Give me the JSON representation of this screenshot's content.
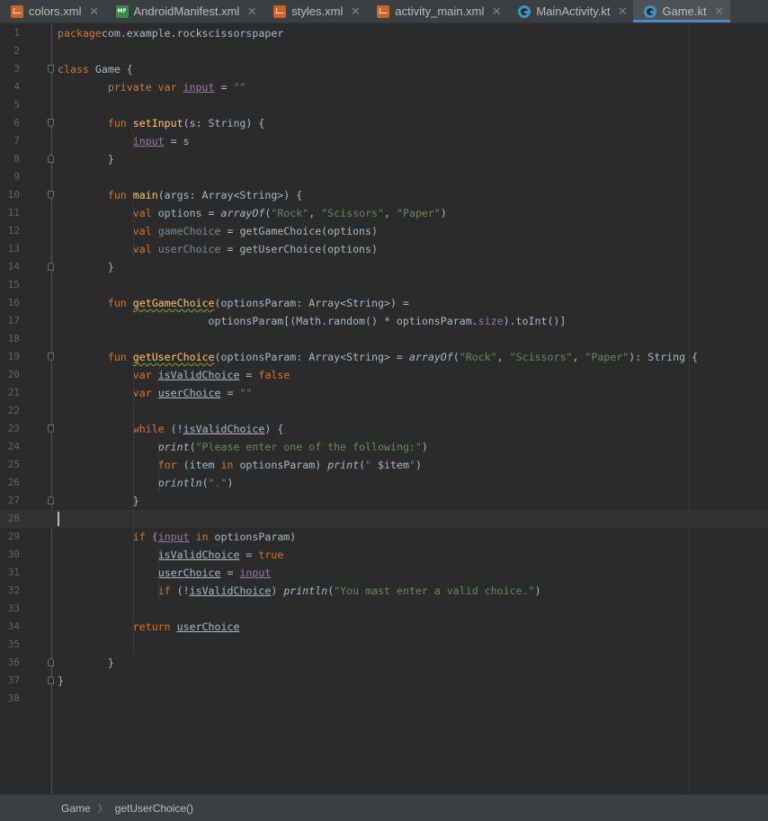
{
  "tabs": [
    {
      "label": "colors.xml",
      "icon": "xml-file-icon",
      "active": false
    },
    {
      "label": "AndroidManifest.xml",
      "icon": "manifest-file-icon",
      "active": false
    },
    {
      "label": "styles.xml",
      "icon": "xml-file-icon",
      "active": false
    },
    {
      "label": "activity_main.xml",
      "icon": "xml-file-icon",
      "active": false
    },
    {
      "label": "MainActivity.kt",
      "icon": "kotlin-class-icon",
      "active": false
    },
    {
      "label": "Game.kt",
      "icon": "kotlin-class-icon",
      "active": true
    }
  ],
  "tab_close_glyph": "✕",
  "colors": {
    "keyword": "#cc7832",
    "string": "#6a8759",
    "function": "#ffc66d",
    "property": "#9876aa",
    "text": "#a9b7c6",
    "background": "#2b2b2b",
    "active_tab_underline": "#4a88c7"
  },
  "editor": {
    "current_line": 28,
    "lines": [
      {
        "n": "1",
        "tokens": [
          [
            "kw",
            "package"
          ],
          [
            "",
            "com.example.rockscissorspaper"
          ]
        ]
      },
      {
        "n": "2",
        "tokens": []
      },
      {
        "n": "3",
        "tokens": [
          [
            "kw",
            "class "
          ],
          [
            "",
            "Game {"
          ]
        ],
        "fold": "open"
      },
      {
        "n": "4",
        "tokens": [
          [
            "",
            "        "
          ],
          [
            "kw",
            "private var "
          ],
          [
            "prop ul",
            "input"
          ],
          [
            "",
            " = "
          ],
          [
            "str",
            "\"\""
          ]
        ]
      },
      {
        "n": "5",
        "tokens": []
      },
      {
        "n": "6",
        "tokens": [
          [
            "",
            "        "
          ],
          [
            "kw",
            "fun "
          ],
          [
            "fn",
            "setInput"
          ],
          [
            "",
            "(s: String) {"
          ]
        ],
        "fold": "open"
      },
      {
        "n": "7",
        "tokens": [
          [
            "",
            "            "
          ],
          [
            "prop ul",
            "input"
          ],
          [
            "",
            " = s"
          ]
        ]
      },
      {
        "n": "8",
        "tokens": [
          [
            "",
            "        }"
          ]
        ],
        "fold": "close"
      },
      {
        "n": "9",
        "tokens": []
      },
      {
        "n": "10",
        "tokens": [
          [
            "",
            "        "
          ],
          [
            "kw",
            "fun "
          ],
          [
            "fn",
            "main"
          ],
          [
            "",
            "(args: Array<String>) {"
          ]
        ],
        "fold": "open"
      },
      {
        "n": "11",
        "tokens": [
          [
            "",
            "            "
          ],
          [
            "kw",
            "val "
          ],
          [
            "",
            "options = "
          ],
          [
            "it",
            "arrayOf"
          ],
          [
            "",
            "("
          ],
          [
            "str",
            "\"Rock\""
          ],
          [
            "",
            ", "
          ],
          [
            "str",
            "\"Scissors\""
          ],
          [
            "",
            ", "
          ],
          [
            "str",
            "\"Paper\""
          ],
          [
            "",
            ")"
          ]
        ]
      },
      {
        "n": "12",
        "tokens": [
          [
            "",
            "            "
          ],
          [
            "kw",
            "val "
          ],
          [
            "muted",
            "gameChoice"
          ],
          [
            "",
            " = getGameChoice(options)"
          ]
        ]
      },
      {
        "n": "13",
        "tokens": [
          [
            "",
            "            "
          ],
          [
            "kw",
            "val "
          ],
          [
            "muted",
            "userChoice"
          ],
          [
            "",
            " = getUserChoice(options)"
          ]
        ]
      },
      {
        "n": "14",
        "tokens": [
          [
            "",
            "        }"
          ]
        ],
        "fold": "close"
      },
      {
        "n": "15",
        "tokens": []
      },
      {
        "n": "16",
        "tokens": [
          [
            "",
            "        "
          ],
          [
            "kw",
            "fun "
          ],
          [
            "fn squig",
            "getGameChoice"
          ],
          [
            "",
            "(optionsParam: Array<String>) ="
          ]
        ]
      },
      {
        "n": "17",
        "tokens": [
          [
            "",
            "                        optionsParam[(Math.random() * optionsParam."
          ],
          [
            "prop",
            "size"
          ],
          [
            "",
            ").toInt()]"
          ]
        ]
      },
      {
        "n": "18",
        "tokens": []
      },
      {
        "n": "19",
        "tokens": [
          [
            "",
            "        "
          ],
          [
            "kw",
            "fun "
          ],
          [
            "fn squig",
            "getUserChoice"
          ],
          [
            "",
            "(optionsParam: Array<String> = "
          ],
          [
            "it",
            "arrayOf"
          ],
          [
            "",
            "("
          ],
          [
            "str",
            "\"Rock\""
          ],
          [
            "",
            ", "
          ],
          [
            "str",
            "\"Scissors\""
          ],
          [
            "",
            ", "
          ],
          [
            "str",
            "\"Paper\""
          ],
          [
            "",
            "): String {"
          ]
        ],
        "fold": "open"
      },
      {
        "n": "20",
        "tokens": [
          [
            "",
            "            "
          ],
          [
            "kw",
            "var "
          ],
          [
            "ul",
            "isValidChoice"
          ],
          [
            "",
            " = "
          ],
          [
            "kw",
            "false"
          ]
        ]
      },
      {
        "n": "21",
        "tokens": [
          [
            "",
            "            "
          ],
          [
            "kw",
            "var "
          ],
          [
            "ul",
            "userChoice"
          ],
          [
            "",
            " = "
          ],
          [
            "str",
            "\"\""
          ]
        ]
      },
      {
        "n": "22",
        "tokens": []
      },
      {
        "n": "23",
        "tokens": [
          [
            "",
            "            "
          ],
          [
            "kw",
            "while "
          ],
          [
            "",
            "(!"
          ],
          [
            "ul",
            "isValidChoice"
          ],
          [
            "",
            ") {"
          ]
        ],
        "fold": "open"
      },
      {
        "n": "24",
        "tokens": [
          [
            "",
            "                "
          ],
          [
            "it",
            "print"
          ],
          [
            "",
            "("
          ],
          [
            "str",
            "\"Please enter one of the following:\""
          ],
          [
            "",
            ")"
          ]
        ]
      },
      {
        "n": "25",
        "tokens": [
          [
            "",
            "                "
          ],
          [
            "kw",
            "for "
          ],
          [
            "",
            "(item "
          ],
          [
            "kw",
            "in "
          ],
          [
            "",
            "optionsParam) "
          ],
          [
            "it",
            "print"
          ],
          [
            "",
            "("
          ],
          [
            "str",
            "\" "
          ],
          [
            "",
            "$item"
          ],
          [
            "str",
            "\""
          ],
          [
            "",
            ")"
          ]
        ]
      },
      {
        "n": "26",
        "tokens": [
          [
            "",
            "                "
          ],
          [
            "it",
            "println"
          ],
          [
            "",
            "("
          ],
          [
            "str",
            "\".\""
          ],
          [
            "",
            ")"
          ]
        ]
      },
      {
        "n": "27",
        "tokens": [
          [
            "",
            "            }"
          ]
        ],
        "fold": "close"
      },
      {
        "n": "28",
        "tokens": []
      },
      {
        "n": "29",
        "tokens": [
          [
            "",
            "            "
          ],
          [
            "kw",
            "if "
          ],
          [
            "",
            "("
          ],
          [
            "prop ul",
            "input"
          ],
          [
            "kw",
            " in "
          ],
          [
            "",
            "optionsParam)"
          ]
        ]
      },
      {
        "n": "30",
        "tokens": [
          [
            "",
            "                "
          ],
          [
            "ul",
            "isValidChoice"
          ],
          [
            "",
            " = "
          ],
          [
            "kw",
            "true"
          ]
        ]
      },
      {
        "n": "31",
        "tokens": [
          [
            "",
            "                "
          ],
          [
            "ul",
            "userChoice"
          ],
          [
            "",
            " = "
          ],
          [
            "prop ul",
            "input"
          ]
        ]
      },
      {
        "n": "32",
        "tokens": [
          [
            "",
            "                "
          ],
          [
            "kw",
            "if "
          ],
          [
            "",
            "(!"
          ],
          [
            "ul",
            "isValidChoice"
          ],
          [
            "",
            ") "
          ],
          [
            "it",
            "println"
          ],
          [
            "",
            "("
          ],
          [
            "str",
            "\"You mast enter a valid choice.\""
          ],
          [
            "",
            ")"
          ]
        ]
      },
      {
        "n": "33",
        "tokens": []
      },
      {
        "n": "34",
        "tokens": [
          [
            "",
            "            "
          ],
          [
            "kw",
            "return "
          ],
          [
            "ul",
            "userChoice"
          ]
        ]
      },
      {
        "n": "35",
        "tokens": []
      },
      {
        "n": "36",
        "tokens": [
          [
            "",
            "        }"
          ]
        ],
        "fold": "close"
      },
      {
        "n": "37",
        "tokens": [
          [
            "",
            "}"
          ]
        ],
        "fold": "close"
      },
      {
        "n": "38",
        "tokens": []
      }
    ]
  },
  "breadcrumb": {
    "items": [
      "Game",
      "getUserChoice()"
    ],
    "separator": "〉"
  }
}
